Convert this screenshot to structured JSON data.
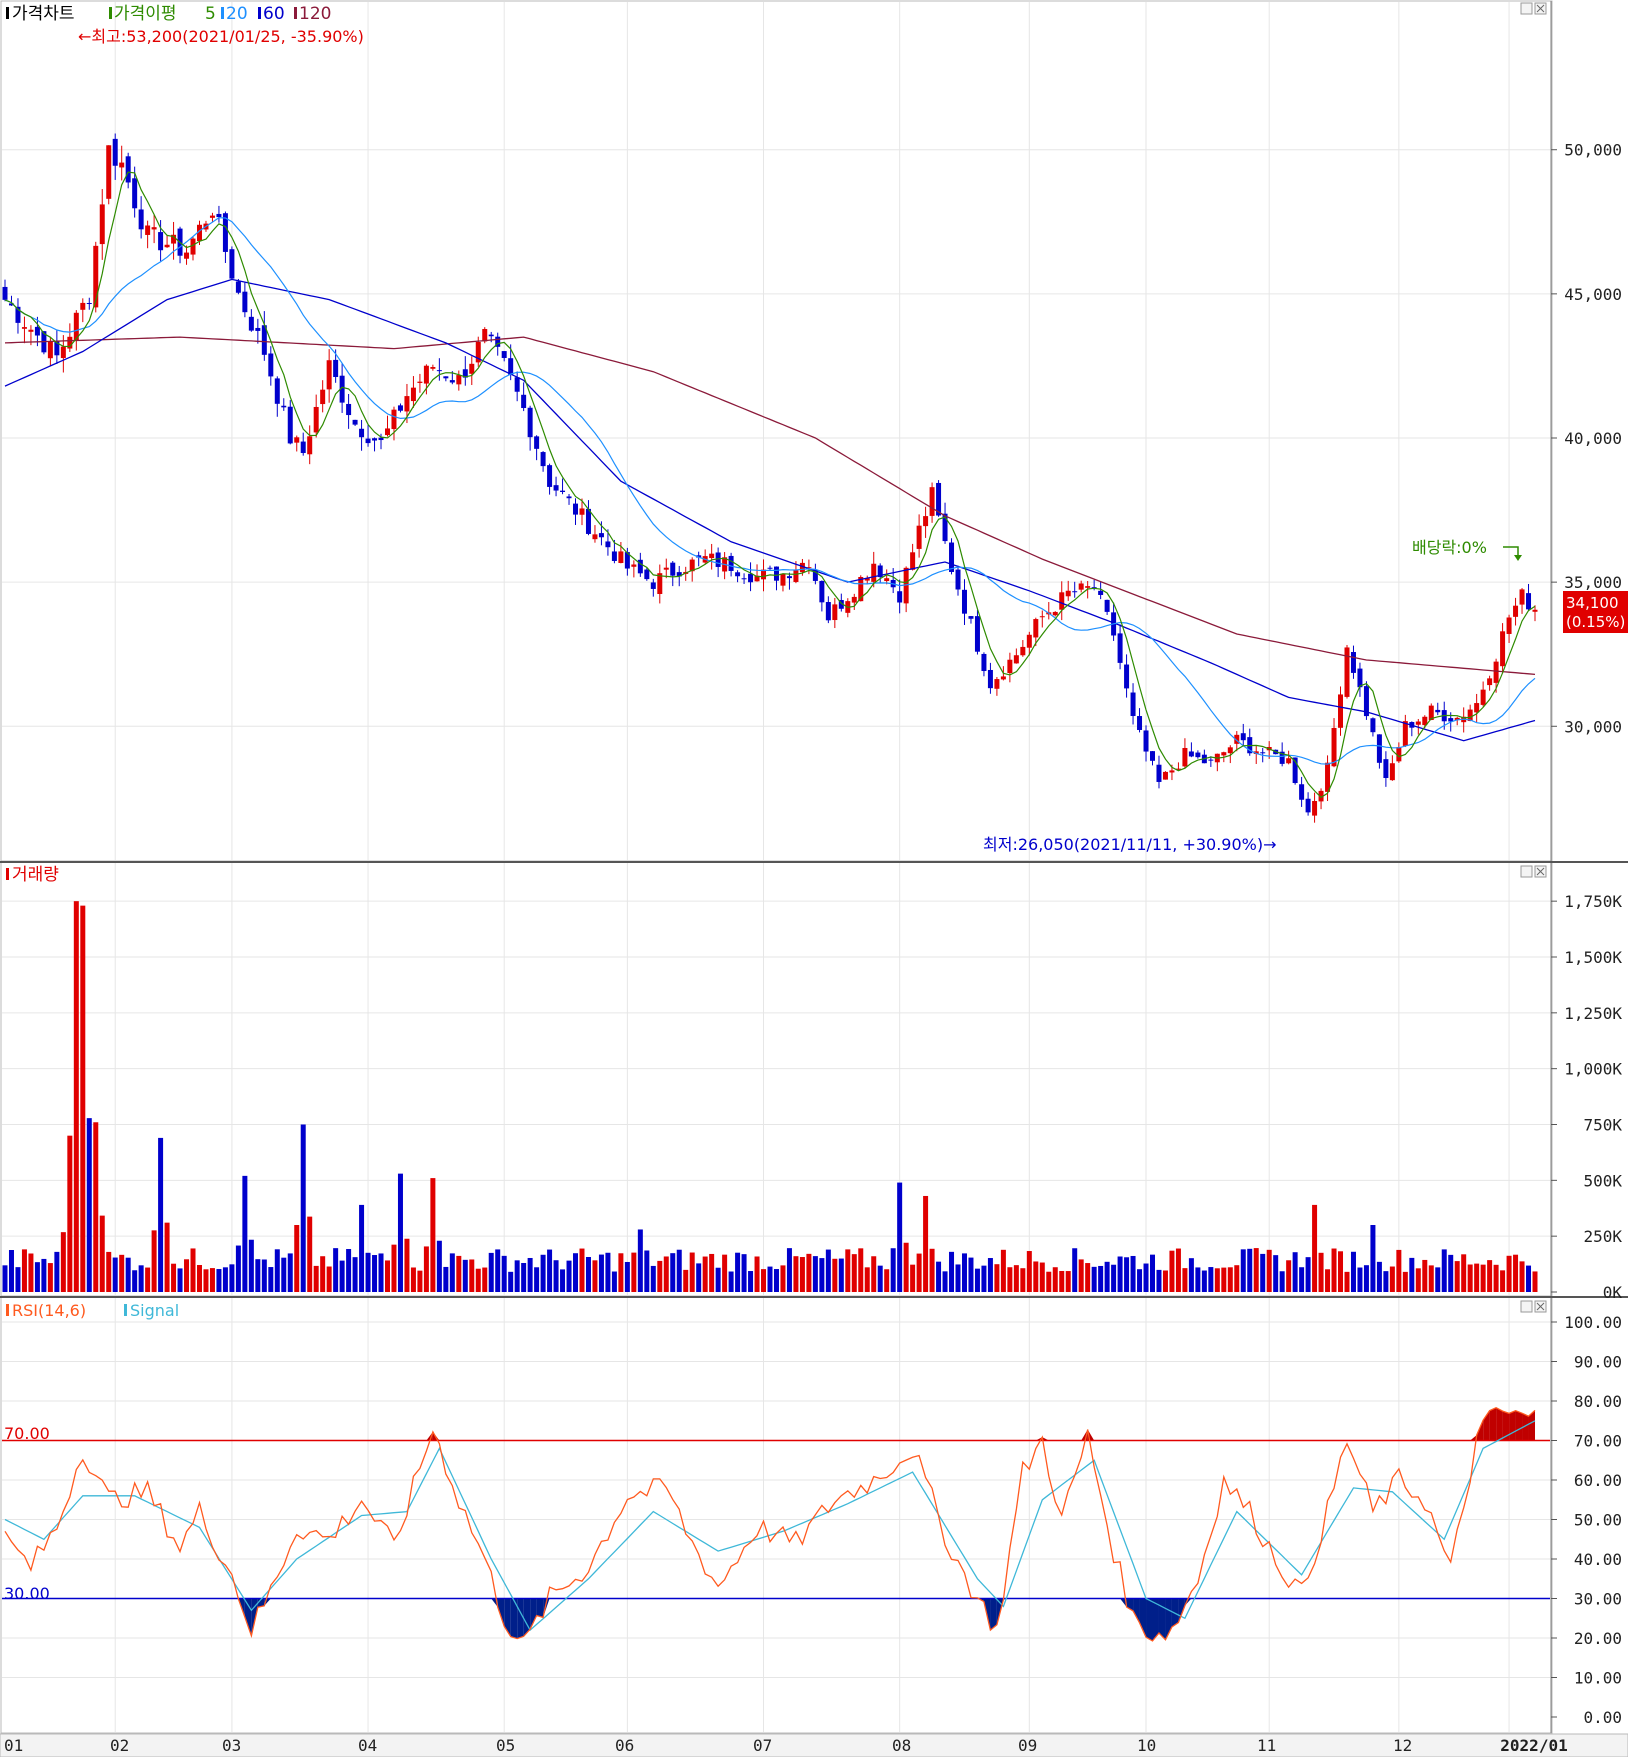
{
  "price_panel": {
    "title": "가격차트",
    "ma_legend_title": "가격이평",
    "ma_legend_items": [
      {
        "label": "5",
        "color": "#2e8b00"
      },
      {
        "label": "20",
        "color": "#1e90ff"
      },
      {
        "label": "60",
        "color": "#0000cc"
      },
      {
        "label": "120",
        "color": "#8b1a3a"
      }
    ],
    "high_annotation": "←최고:53,200(2021/01/25, -35.90%)",
    "low_annotation": "최저:26,050(2021/11/11, +30.90%)→",
    "dividend_annotation": "배당락:0%",
    "current_price": "34,100",
    "current_change": "(0.15%)",
    "y_ticks": [
      "50,000",
      "45,000",
      "40,000",
      "35,000",
      "30,000"
    ]
  },
  "volume_panel": {
    "title": "거래량",
    "y_ticks": [
      "1,750K",
      "1,500K",
      "1,250K",
      "1,000K",
      "750K",
      "500K",
      "250K",
      "0K"
    ]
  },
  "rsi_panel": {
    "title": "RSI(14,6)",
    "signal_label": "Signal",
    "line_70": "70.00",
    "line_30": "30.00",
    "y_ticks": [
      "100.00",
      "90.00",
      "80.00",
      "70.00",
      "60.00",
      "50.00",
      "40.00",
      "30.00",
      "20.00",
      "10.00",
      "0.00"
    ]
  },
  "x_axis": {
    "labels": [
      "01",
      "02",
      "03",
      "04",
      "05",
      "06",
      "07",
      "08",
      "09",
      "10",
      "11",
      "12",
      "2022/01"
    ]
  },
  "colors": {
    "up": "#e00000",
    "down": "#0000cc",
    "ma5": "#2e8b00",
    "ma20": "#1e90ff",
    "ma60": "#0000cc",
    "ma120": "#8b1a3a",
    "rsi": "#ff5a1f",
    "signal": "#3fb8d8",
    "grid": "#e6e6e6",
    "current_box": "#e00000"
  },
  "chart_data": [
    {
      "type": "candlestick",
      "title": "가격차트",
      "ylim": [
        25500,
        54500
      ],
      "months": [
        "2021/01",
        "2021/02",
        "2021/03",
        "2021/04",
        "2021/05",
        "2021/06",
        "2021/07",
        "2021/08",
        "2021/09",
        "2021/10",
        "2021/11",
        "2021/12",
        "2022/01"
      ],
      "close_anchors": [
        {
          "i": 0,
          "v": 44800
        },
        {
          "i": 8,
          "v": 42800
        },
        {
          "i": 13,
          "v": 45000
        },
        {
          "i": 16,
          "v": 50000
        },
        {
          "i": 18,
          "v": 49500
        },
        {
          "i": 22,
          "v": 47000
        },
        {
          "i": 28,
          "v": 46500
        },
        {
          "i": 32,
          "v": 48000
        },
        {
          "i": 36,
          "v": 45000
        },
        {
          "i": 40,
          "v": 43000
        },
        {
          "i": 44,
          "v": 40000
        },
        {
          "i": 46,
          "v": 39500
        },
        {
          "i": 50,
          "v": 42500
        },
        {
          "i": 54,
          "v": 40500
        },
        {
          "i": 58,
          "v": 39800
        },
        {
          "i": 62,
          "v": 41500
        },
        {
          "i": 66,
          "v": 42500
        },
        {
          "i": 70,
          "v": 42000
        },
        {
          "i": 74,
          "v": 43500
        },
        {
          "i": 77,
          "v": 42500
        },
        {
          "i": 80,
          "v": 41000
        },
        {
          "i": 84,
          "v": 38500
        },
        {
          "i": 88,
          "v": 37500
        },
        {
          "i": 92,
          "v": 36500
        },
        {
          "i": 96,
          "v": 35500
        },
        {
          "i": 100,
          "v": 35000
        },
        {
          "i": 104,
          "v": 35500
        },
        {
          "i": 108,
          "v": 35800
        },
        {
          "i": 112,
          "v": 35600
        },
        {
          "i": 116,
          "v": 35200
        },
        {
          "i": 120,
          "v": 35300
        },
        {
          "i": 124,
          "v": 35800
        },
        {
          "i": 127,
          "v": 33800
        },
        {
          "i": 131,
          "v": 34800
        },
        {
          "i": 134,
          "v": 35700
        },
        {
          "i": 138,
          "v": 34600
        },
        {
          "i": 141,
          "v": 36800
        },
        {
          "i": 143,
          "v": 38000
        },
        {
          "i": 146,
          "v": 35500
        },
        {
          "i": 149,
          "v": 33500
        },
        {
          "i": 152,
          "v": 31500
        },
        {
          "i": 156,
          "v": 32500
        },
        {
          "i": 160,
          "v": 33800
        },
        {
          "i": 164,
          "v": 34600
        },
        {
          "i": 168,
          "v": 34800
        },
        {
          "i": 171,
          "v": 33200
        },
        {
          "i": 174,
          "v": 30200
        },
        {
          "i": 178,
          "v": 28000
        },
        {
          "i": 182,
          "v": 29000
        },
        {
          "i": 186,
          "v": 28700
        },
        {
          "i": 190,
          "v": 29500
        },
        {
          "i": 194,
          "v": 29100
        },
        {
          "i": 198,
          "v": 28800
        },
        {
          "i": 201,
          "v": 27000
        },
        {
          "i": 204,
          "v": 28500
        },
        {
          "i": 207,
          "v": 32800
        },
        {
          "i": 210,
          "v": 30500
        },
        {
          "i": 213,
          "v": 28000
        },
        {
          "i": 216,
          "v": 30000
        },
        {
          "i": 220,
          "v": 30500
        },
        {
          "i": 224,
          "v": 30300
        },
        {
          "i": 227,
          "v": 30800
        },
        {
          "i": 230,
          "v": 32500
        },
        {
          "i": 232,
          "v": 33800
        },
        {
          "i": 234,
          "v": 34500
        },
        {
          "i": 236,
          "v": 34100
        }
      ],
      "n_bars": 237,
      "ma120_anchors": [
        {
          "i": 0,
          "v": 43300
        },
        {
          "i": 27,
          "v": 43500
        },
        {
          "i": 60,
          "v": 43100
        },
        {
          "i": 80,
          "v": 43500
        },
        {
          "i": 100,
          "v": 42300
        },
        {
          "i": 125,
          "v": 40000
        },
        {
          "i": 145,
          "v": 37300
        },
        {
          "i": 160,
          "v": 35800
        },
        {
          "i": 175,
          "v": 34500
        },
        {
          "i": 190,
          "v": 33200
        },
        {
          "i": 210,
          "v": 32300
        },
        {
          "i": 236,
          "v": 31800
        }
      ],
      "ma60_anchors": [
        {
          "i": 0,
          "v": 41800
        },
        {
          "i": 12,
          "v": 43000
        },
        {
          "i": 25,
          "v": 44800
        },
        {
          "i": 35,
          "v": 45500
        },
        {
          "i": 50,
          "v": 44800
        },
        {
          "i": 68,
          "v": 43300
        },
        {
          "i": 80,
          "v": 42000
        },
        {
          "i": 95,
          "v": 38500
        },
        {
          "i": 112,
          "v": 36400
        },
        {
          "i": 130,
          "v": 35000
        },
        {
          "i": 145,
          "v": 35700
        },
        {
          "i": 158,
          "v": 34700
        },
        {
          "i": 172,
          "v": 33500
        },
        {
          "i": 186,
          "v": 32200
        },
        {
          "i": 198,
          "v": 31000
        },
        {
          "i": 210,
          "v": 30500
        },
        {
          "i": 225,
          "v": 29500
        },
        {
          "i": 236,
          "v": 30200
        }
      ],
      "high": {
        "value": 53200,
        "date": "2021/01/25"
      },
      "low": {
        "value": 26050,
        "date": "2021/11/11"
      },
      "last": {
        "value": 34100,
        "change_pct": 0.15
      }
    },
    {
      "type": "bar",
      "title": "거래량",
      "ylim": [
        0,
        1800000
      ],
      "peak_anchors": [
        {
          "i": 10,
          "v": 670000
        },
        {
          "i": 11,
          "v": 1750000
        },
        {
          "i": 12,
          "v": 1730000
        },
        {
          "i": 14,
          "v": 760000
        },
        {
          "i": 24,
          "v": 690000
        },
        {
          "i": 37,
          "v": 520000
        },
        {
          "i": 46,
          "v": 750000
        },
        {
          "i": 55,
          "v": 390000
        },
        {
          "i": 61,
          "v": 530000
        },
        {
          "i": 66,
          "v": 510000
        },
        {
          "i": 98,
          "v": 280000
        },
        {
          "i": 138,
          "v": 490000
        },
        {
          "i": 142,
          "v": 430000
        },
        {
          "i": 202,
          "v": 390000
        },
        {
          "i": 211,
          "v": 300000
        }
      ],
      "baseline_volume": 90000
    },
    {
      "type": "line",
      "title": "RSI(14,6)",
      "series": [
        {
          "name": "RSI(14,6)",
          "anchors": [
            {
              "i": 0,
              "v": 45
            },
            {
              "i": 4,
              "v": 38
            },
            {
              "i": 8,
              "v": 48
            },
            {
              "i": 12,
              "v": 68
            },
            {
              "i": 16,
              "v": 55
            },
            {
              "i": 22,
              "v": 57
            },
            {
              "i": 27,
              "v": 43
            },
            {
              "i": 30,
              "v": 52
            },
            {
              "i": 35,
              "v": 36
            },
            {
              "i": 38,
              "v": 22
            },
            {
              "i": 41,
              "v": 32
            },
            {
              "i": 45,
              "v": 48
            },
            {
              "i": 50,
              "v": 45
            },
            {
              "i": 55,
              "v": 55
            },
            {
              "i": 60,
              "v": 43
            },
            {
              "i": 66,
              "v": 73
            },
            {
              "i": 70,
              "v": 55
            },
            {
              "i": 74,
              "v": 40
            },
            {
              "i": 77,
              "v": 25
            },
            {
              "i": 80,
              "v": 18
            },
            {
              "i": 84,
              "v": 30
            },
            {
              "i": 90,
              "v": 38
            },
            {
              "i": 96,
              "v": 56
            },
            {
              "i": 102,
              "v": 58
            },
            {
              "i": 106,
              "v": 44
            },
            {
              "i": 110,
              "v": 33
            },
            {
              "i": 116,
              "v": 48
            },
            {
              "i": 122,
              "v": 44
            },
            {
              "i": 128,
              "v": 55
            },
            {
              "i": 134,
              "v": 60
            },
            {
              "i": 140,
              "v": 68
            },
            {
              "i": 146,
              "v": 42
            },
            {
              "i": 150,
              "v": 30
            },
            {
              "i": 153,
              "v": 22
            },
            {
              "i": 157,
              "v": 62
            },
            {
              "i": 160,
              "v": 70
            },
            {
              "i": 163,
              "v": 50
            },
            {
              "i": 167,
              "v": 71
            },
            {
              "i": 171,
              "v": 42
            },
            {
              "i": 174,
              "v": 25
            },
            {
              "i": 177,
              "v": 21
            },
            {
              "i": 180,
              "v": 22
            },
            {
              "i": 184,
              "v": 35
            },
            {
              "i": 188,
              "v": 60
            },
            {
              "i": 192,
              "v": 52
            },
            {
              "i": 196,
              "v": 40
            },
            {
              "i": 200,
              "v": 31
            },
            {
              "i": 204,
              "v": 52
            },
            {
              "i": 207,
              "v": 70
            },
            {
              "i": 211,
              "v": 52
            },
            {
              "i": 215,
              "v": 60
            },
            {
              "i": 219,
              "v": 55
            },
            {
              "i": 223,
              "v": 37
            },
            {
              "i": 227,
              "v": 70
            },
            {
              "i": 230,
              "v": 78
            },
            {
              "i": 233,
              "v": 76
            },
            {
              "i": 236,
              "v": 76
            }
          ]
        },
        {
          "name": "Signal",
          "anchors": [
            {
              "i": 0,
              "v": 50
            },
            {
              "i": 6,
              "v": 45
            },
            {
              "i": 12,
              "v": 56
            },
            {
              "i": 20,
              "v": 56
            },
            {
              "i": 30,
              "v": 48
            },
            {
              "i": 38,
              "v": 27
            },
            {
              "i": 45,
              "v": 40
            },
            {
              "i": 55,
              "v": 51
            },
            {
              "i": 62,
              "v": 52
            },
            {
              "i": 67,
              "v": 68
            },
            {
              "i": 75,
              "v": 40
            },
            {
              "i": 81,
              "v": 22
            },
            {
              "i": 90,
              "v": 35
            },
            {
              "i": 100,
              "v": 52
            },
            {
              "i": 110,
              "v": 42
            },
            {
              "i": 120,
              "v": 47
            },
            {
              "i": 130,
              "v": 54
            },
            {
              "i": 140,
              "v": 62
            },
            {
              "i": 150,
              "v": 35
            },
            {
              "i": 154,
              "v": 28
            },
            {
              "i": 160,
              "v": 55
            },
            {
              "i": 168,
              "v": 65
            },
            {
              "i": 176,
              "v": 30
            },
            {
              "i": 182,
              "v": 25
            },
            {
              "i": 190,
              "v": 52
            },
            {
              "i": 200,
              "v": 36
            },
            {
              "i": 208,
              "v": 58
            },
            {
              "i": 214,
              "v": 57
            },
            {
              "i": 222,
              "v": 45
            },
            {
              "i": 228,
              "v": 68
            },
            {
              "i": 236,
              "v": 75
            }
          ]
        }
      ],
      "ylim": [
        0,
        100
      ],
      "levels": [
        70,
        30
      ]
    }
  ]
}
